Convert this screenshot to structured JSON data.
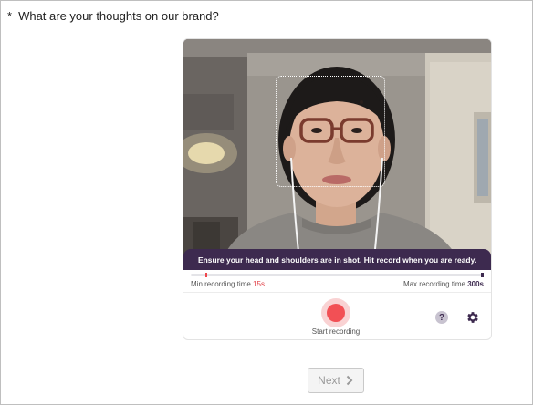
{
  "question": {
    "required_marker": "*",
    "text": "What are your thoughts on our brand?"
  },
  "recorder": {
    "instruction": "Ensure your head and shoulders are in shot. Hit record when you are ready.",
    "min_label": "Min recording time",
    "min_value": "15s",
    "max_label": "Max recording time",
    "max_value": "300s",
    "record_label": "Start recording",
    "help_glyph": "?",
    "icons": {
      "record": "record-icon",
      "help": "help-icon",
      "settings": "gear-icon"
    },
    "colors": {
      "accent": "#3d2a4f",
      "record": "#f25055",
      "min_marker": "#f0474d"
    }
  },
  "footer": {
    "next_label": "Next",
    "next_icon": "chevron-right-icon"
  }
}
